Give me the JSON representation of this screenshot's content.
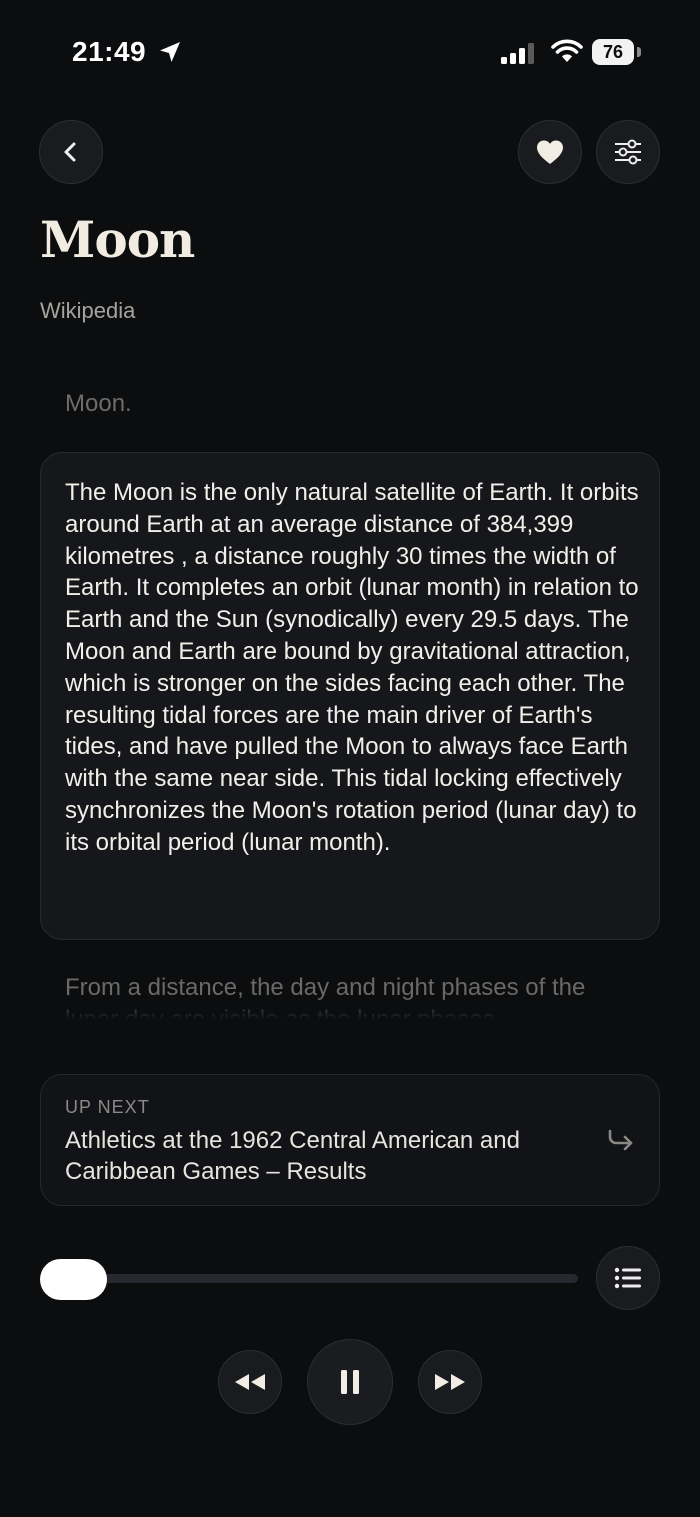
{
  "status_bar": {
    "time": "21:49",
    "battery": "76"
  },
  "article": {
    "title": "Moon",
    "source": "Wikipedia",
    "previous_paragraph": "Moon.",
    "current_paragraph": "The Moon is the only natural satellite of Earth. It orbits around Earth at an average distance of 384,399 kilometres , a distance roughly 30 times the width of Earth. It completes an orbit (lunar month) in relation to Earth and the Sun (synodically) every 29.5 days. The Moon and Earth are bound by gravitational attraction, which is stronger on the sides facing each other. The resulting tidal forces are the main driver of Earth's tides, and have pulled the Moon to always face Earth with the same near side. This tidal locking effectively synchronizes the Moon's rotation period (lunar day) to its orbital period (lunar month).",
    "next_paragraph": "From a distance, the day and night phases of the lunar day are visible as the lunar phases"
  },
  "up_next": {
    "label": "UP NEXT",
    "title": "Athletics at the 1962 Central American and Caribbean Games – Results"
  },
  "player": {
    "progress_fraction": 0.0
  },
  "icons": {
    "back": "chevron-left-icon",
    "favorite": "heart-icon",
    "settings": "sliders-icon",
    "queue": "list-icon",
    "rewind": "rewind-icon",
    "pause": "pause-icon",
    "forward": "fast-forward-icon",
    "up_next_arrow": "redo-arrow-icon"
  },
  "colors": {
    "background": "#0c0d0f",
    "card": "#15171a",
    "text": "#f2efe9",
    "muted": "#6d6c6a"
  }
}
